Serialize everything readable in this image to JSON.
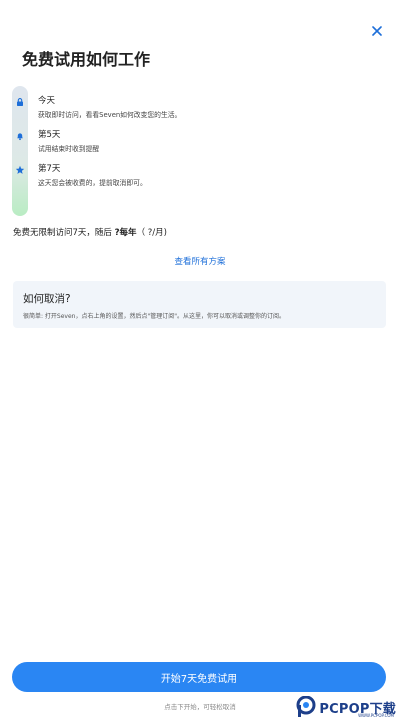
{
  "header": {
    "title": "免费试用如何工作",
    "close_icon": "close-icon"
  },
  "timeline": [
    {
      "heading": "今天",
      "description": "获取即时访问，看看Seven如何改变您的生活。",
      "icon": "lock-icon"
    },
    {
      "heading": "第5天",
      "description": "试用结束时收到提醒",
      "icon": "bell-icon"
    },
    {
      "heading": "第7天",
      "description": "这天您会被收费的，提前取消即可。",
      "icon": "star-icon"
    }
  ],
  "summary": {
    "text_prefix": "免费无限制访问7天，随后 ",
    "price": "?每年",
    "text_suffix": "（ ?/月)"
  },
  "links": {
    "view_all_plans": "查看所有方案"
  },
  "cancel_info": {
    "title": "如何取消?",
    "description": "很简单: 打开Seven，点右上角的设置，然后点\"管理订阅\"。从这里，你可以取消或调整你的订阅。"
  },
  "cta": {
    "label": "开始7天免费试用",
    "footnote": "点击下开始，可轻松取消"
  },
  "watermark": {
    "text": "PCPOP下载",
    "subtext": "WWW.PCPOP.COM"
  },
  "colors": {
    "accent": "#2a86f3",
    "link": "#1e6fd9",
    "timeline_icon": "#1e6fd9",
    "card_background": "#f1f5fa"
  }
}
